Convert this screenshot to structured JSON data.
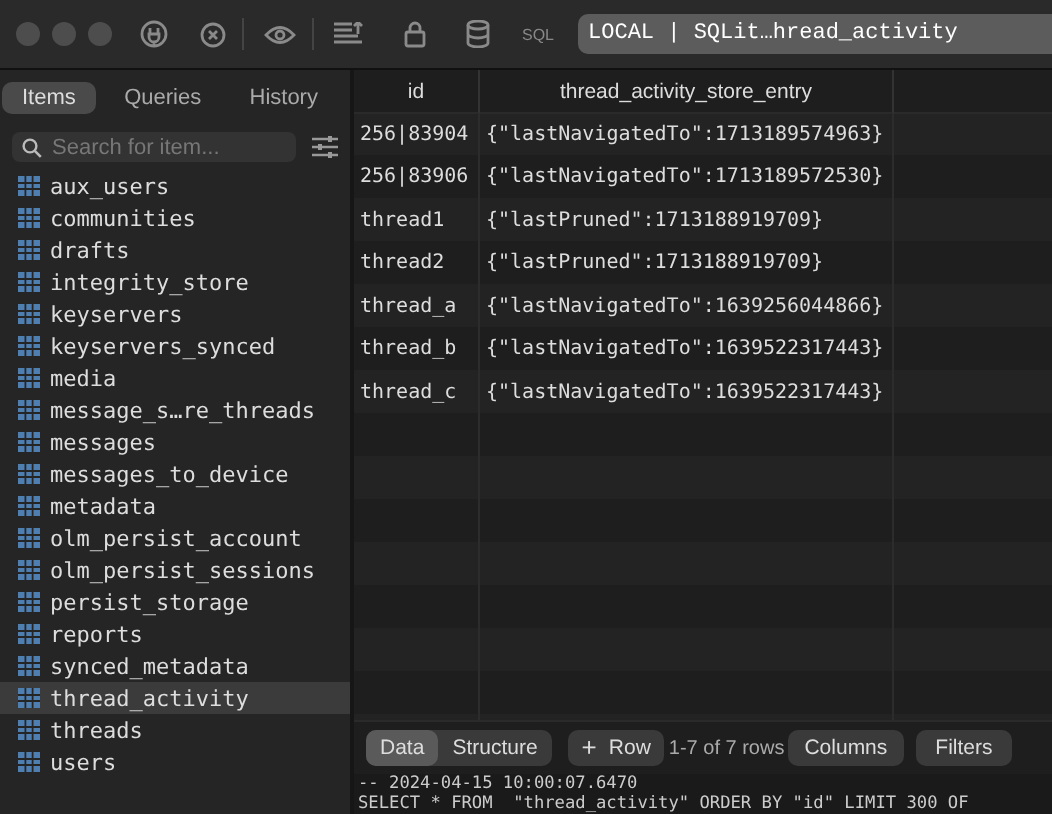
{
  "toolbar": {
    "sql_label": "SQL",
    "connection": "LOCAL | SQLit…hread_activity"
  },
  "sidebar": {
    "tabs": [
      {
        "label": "Items",
        "selected": true
      },
      {
        "label": "Queries",
        "selected": false
      },
      {
        "label": "History",
        "selected": false
      }
    ],
    "search": {
      "placeholder": "Search for item..."
    },
    "items": [
      {
        "label": "aux_users",
        "selected": false
      },
      {
        "label": "communities",
        "selected": false
      },
      {
        "label": "drafts",
        "selected": false
      },
      {
        "label": "integrity_store",
        "selected": false
      },
      {
        "label": "keyservers",
        "selected": false
      },
      {
        "label": "keyservers_synced",
        "selected": false
      },
      {
        "label": "media",
        "selected": false
      },
      {
        "label": "message_s…re_threads",
        "selected": false
      },
      {
        "label": "messages",
        "selected": false
      },
      {
        "label": "messages_to_device",
        "selected": false
      },
      {
        "label": "metadata",
        "selected": false
      },
      {
        "label": "olm_persist_account",
        "selected": false
      },
      {
        "label": "olm_persist_sessions",
        "selected": false
      },
      {
        "label": "persist_storage",
        "selected": false
      },
      {
        "label": "reports",
        "selected": false
      },
      {
        "label": "synced_metadata",
        "selected": false
      },
      {
        "label": "thread_activity",
        "selected": true
      },
      {
        "label": "threads",
        "selected": false
      },
      {
        "label": "users",
        "selected": false
      }
    ]
  },
  "table": {
    "columns": [
      "id",
      "thread_activity_store_entry"
    ],
    "rows": [
      [
        "256|83904",
        "{\"lastNavigatedTo\":1713189574963}"
      ],
      [
        "256|83906",
        "{\"lastNavigatedTo\":1713189572530}"
      ],
      [
        "thread1",
        "{\"lastPruned\":1713188919709}"
      ],
      [
        "thread2",
        "{\"lastPruned\":1713188919709}"
      ],
      [
        "thread_a",
        "{\"lastNavigatedTo\":1639256044866}"
      ],
      [
        "thread_b",
        "{\"lastNavigatedTo\":1639522317443}"
      ],
      [
        "thread_c",
        "{\"lastNavigatedTo\":1639522317443}"
      ]
    ]
  },
  "bottom_bar": {
    "view_tabs": [
      {
        "label": "Data",
        "selected": true
      },
      {
        "label": "Structure",
        "selected": false
      }
    ],
    "add_row": {
      "icon": "+",
      "label": "Row"
    },
    "row_count": "1-7 of 7 rows",
    "columns_button": "Columns",
    "filters_button": "Filters"
  },
  "console": [
    "-- 2024-04-15 10:00:07.6470",
    "SELECT * FROM  \"thread_activity\" ORDER BY \"id\" LIMIT 300 OF"
  ]
}
